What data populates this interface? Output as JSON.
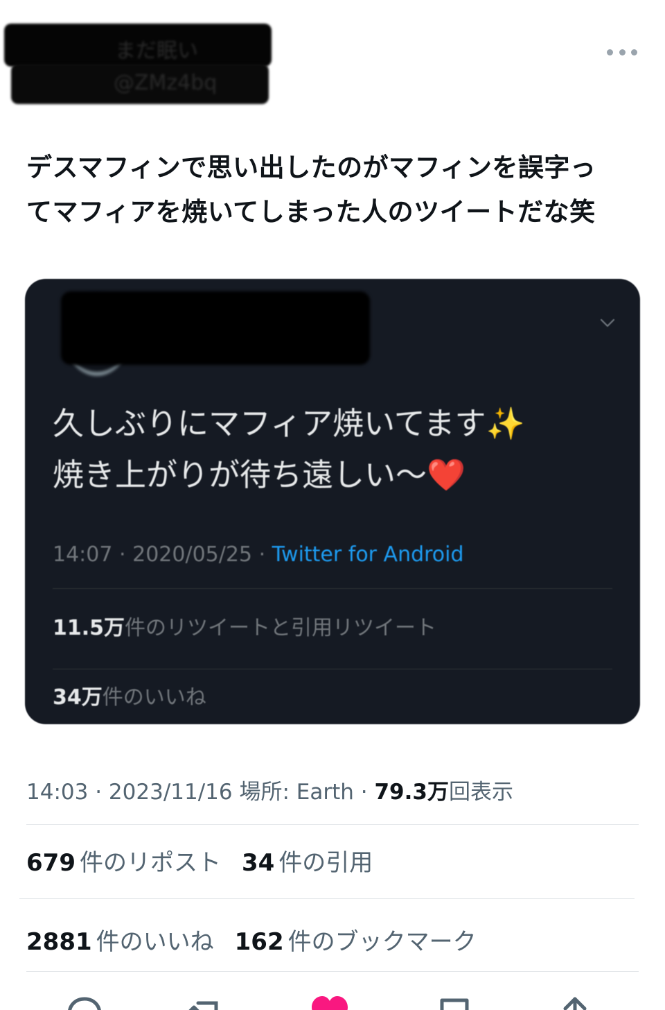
{
  "header": {
    "display_name": "まだ眠い",
    "handle": "@ZMz4bq"
  },
  "tweet": {
    "text_line1": "デスマフィンで思い出したのがマフィンを誤字っ",
    "text_line2": "てマフィアを焼いてしまった人のツイートだな笑"
  },
  "embedded": {
    "text_line1": "久しぶりにマフィア焼いてます✨",
    "text_line2": "焼き上がりが待ち遠しい〜❤️",
    "time": "14:07",
    "date": "2020/05/25",
    "sep": "·",
    "source": "Twitter for Android",
    "retweets_count": "11.5万",
    "retweets_label": "件のリツイートと引用リツイート",
    "likes_count": "34万",
    "likes_label": "件のいいね"
  },
  "meta": {
    "time": "14:03",
    "date": "2023/11/16",
    "place_label": "場所: Earth",
    "views_count": "79.3万",
    "views_label": "回表示",
    "sep": "·"
  },
  "stats": {
    "reposts_count": "679",
    "reposts_label": "件のリポスト",
    "quotes_count": "34",
    "quotes_label": "件の引用",
    "likes_count": "2881",
    "likes_label": "件のいいね",
    "bookmarks_count": "162",
    "bookmarks_label": "件のブックマーク"
  },
  "colors": {
    "like_active": "#f91880",
    "link": "#1d9bf0",
    "muted": "#536471"
  }
}
